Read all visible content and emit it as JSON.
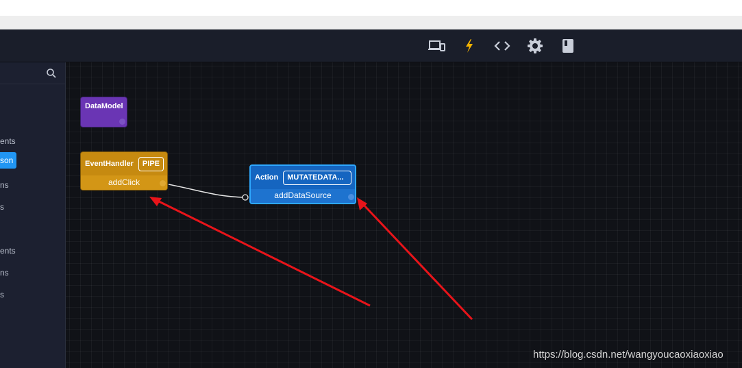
{
  "toolbar": {
    "icons": [
      "responsive-devices-icon",
      "lightning-icon",
      "code-icon",
      "settings-gear-icon",
      "book-icon"
    ],
    "active_color": "#f6b400",
    "icon_color": "#c9ced9"
  },
  "sidebar": {
    "search_icon": "search-icon",
    "items": [
      {
        "label": "ents"
      },
      {
        "label": "son"
      },
      {
        "label": "ns"
      },
      {
        "label": "s"
      },
      {
        "label": "ents"
      },
      {
        "label": "ns"
      },
      {
        "label": "s"
      }
    ]
  },
  "canvas": {
    "nodes": {
      "datamodel": {
        "title": "DataModel",
        "color": "#6a35b4"
      },
      "eventhandler": {
        "title": "EventHandler",
        "chip": "PIPE",
        "footer": "addClick",
        "color": "#c68a10"
      },
      "action": {
        "title": "Action",
        "chip": "MUTATEDATA...",
        "footer": "addDataSource",
        "color": "#1565c0",
        "border_color": "#2ea8ff"
      }
    },
    "annotation_color": "#e8141a"
  },
  "watermark": "https://blog.csdn.net/wangyoucaoxiaoxiao"
}
